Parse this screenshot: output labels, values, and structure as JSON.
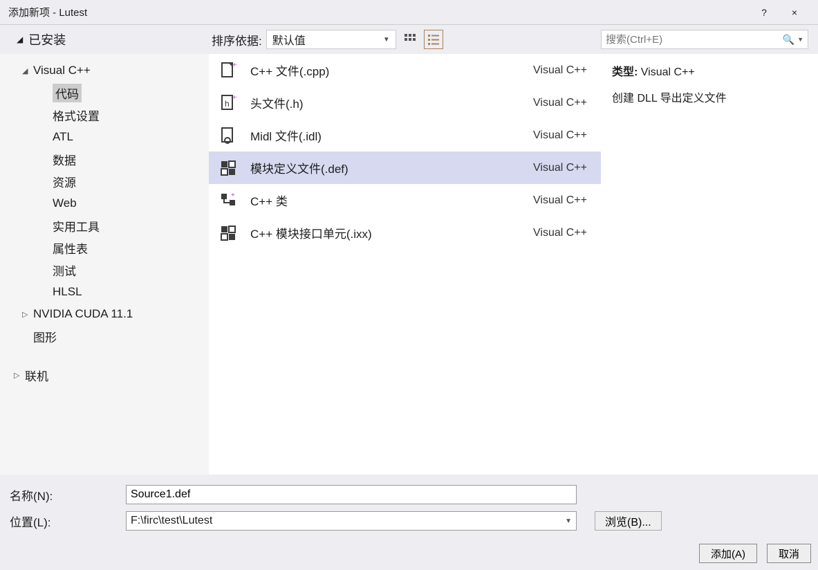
{
  "window": {
    "title": "添加新项 - Lutest",
    "help": "?",
    "close": "×"
  },
  "tree": {
    "installed_label": "已安装",
    "online_label": "联机",
    "nodes": [
      {
        "label": "Visual C++",
        "arrow": "◢",
        "level": 1
      },
      {
        "label": "代码",
        "level": 2,
        "selected": true
      },
      {
        "label": "格式设置",
        "level": 2
      },
      {
        "label": "ATL",
        "level": 2
      },
      {
        "label": "数据",
        "level": 2
      },
      {
        "label": "资源",
        "level": 2
      },
      {
        "label": "Web",
        "level": 2
      },
      {
        "label": "实用工具",
        "level": 2
      },
      {
        "label": "属性表",
        "level": 2
      },
      {
        "label": "测试",
        "level": 2
      },
      {
        "label": "HLSL",
        "level": 2
      },
      {
        "label": "NVIDIA CUDA 11.1",
        "arrow": "▷",
        "level": 1
      },
      {
        "label": "图形",
        "level": 1,
        "noarrow": true
      }
    ]
  },
  "toolbar": {
    "sort_label": "排序依据:",
    "sort_value": "默认值"
  },
  "search": {
    "placeholder": "搜索(Ctrl+E)"
  },
  "templates": [
    {
      "label": "C++ 文件(.cpp)",
      "type": "Visual C++",
      "icon": "cpp"
    },
    {
      "label": "头文件(.h)",
      "type": "Visual C++",
      "icon": "header"
    },
    {
      "label": "Midl 文件(.idl)",
      "type": "Visual C++",
      "icon": "idl"
    },
    {
      "label": "模块定义文件(.def)",
      "type": "Visual C++",
      "icon": "def",
      "selected": true
    },
    {
      "label": "C++ 类",
      "type": "Visual C++",
      "icon": "class"
    },
    {
      "label": "C++ 模块接口单元(.ixx)",
      "type": "Visual C++",
      "icon": "module"
    }
  ],
  "details": {
    "type_label": "类型:",
    "type_value": "Visual C++",
    "description": "创建 DLL 导出定义文件"
  },
  "form": {
    "name_label": "名称(N):",
    "name_value": "Source1.def",
    "location_label": "位置(L):",
    "location_value": "F:\\firc\\test\\Lutest",
    "browse_label": "浏览(B)..."
  },
  "actions": {
    "add": "添加(A)",
    "cancel": "取消"
  }
}
